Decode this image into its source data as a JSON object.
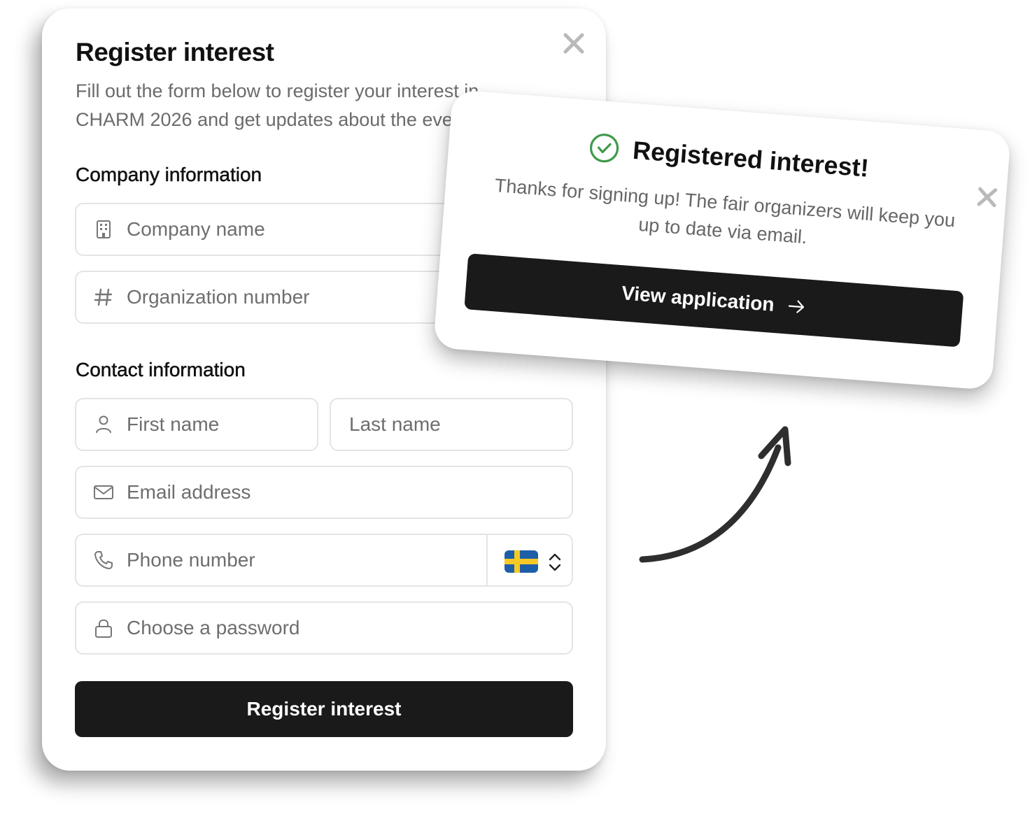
{
  "modal": {
    "title": "Register interest",
    "subtitle": "Fill out the form below to register your interest in CHARM 2026 and get updates about the event.",
    "close_icon": "close-icon"
  },
  "company_section": {
    "heading": "Company information",
    "company_name": {
      "placeholder": "Company name",
      "icon": "building-icon"
    },
    "org_number": {
      "placeholder": "Organization number",
      "icon": "hash-icon"
    }
  },
  "contact_section": {
    "heading": "Contact information",
    "first_name": {
      "placeholder": "First name",
      "icon": "user-icon"
    },
    "last_name": {
      "placeholder": "Last name"
    },
    "email": {
      "placeholder": "Email address",
      "icon": "mail-icon"
    },
    "phone": {
      "placeholder": "Phone number",
      "icon": "phone-icon",
      "country_flag": "sweden-flag-icon"
    },
    "password": {
      "placeholder": "Choose a password",
      "icon": "lock-icon"
    }
  },
  "submit_label": "Register interest",
  "popup": {
    "title": "Registered interest!",
    "message": "Thanks for signing up! The fair organizers will keep you up to date via email.",
    "button_label": "View application",
    "check_icon": "check-circle-icon",
    "close_icon": "close-icon"
  },
  "colors": {
    "primary_button": "#1a1a1a",
    "success": "#3f9a4a",
    "muted_text": "#6b6b6b",
    "border": "#e4e4e4"
  }
}
